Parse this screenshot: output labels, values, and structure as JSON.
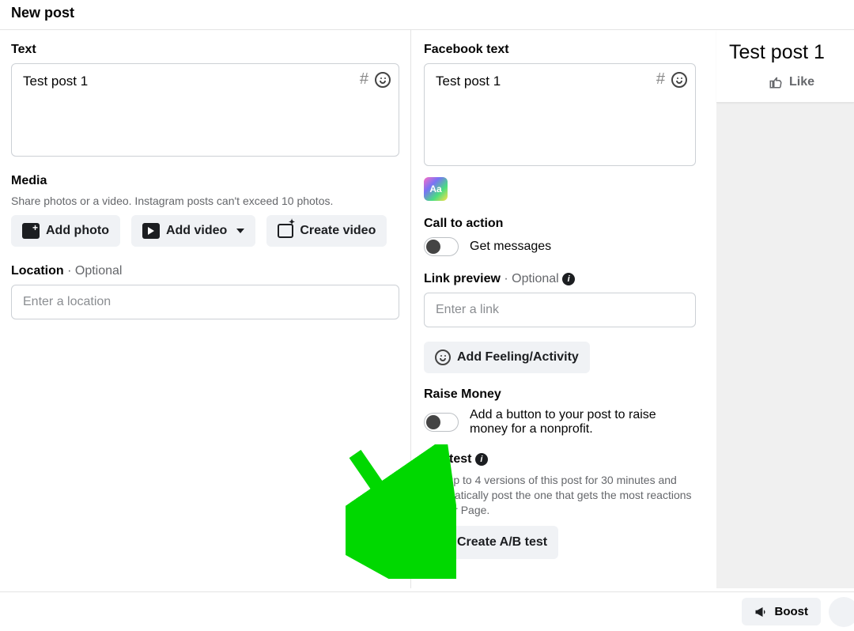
{
  "header": {
    "title": "New post"
  },
  "left": {
    "text_label": "Text",
    "text_value": "Test post 1",
    "media_label": "Media",
    "media_subtext": "Share photos or a video. Instagram posts can't exceed 10 photos.",
    "add_photo": "Add photo",
    "add_video": "Add video",
    "create_video": "Create video",
    "location_label": "Location",
    "location_optional": " · Optional",
    "location_placeholder": "Enter a location"
  },
  "right": {
    "fb_text_label": "Facebook text",
    "fb_text_value": "Test post 1",
    "aa_label": "Aa",
    "cta_label": "Call to action",
    "cta_get_messages": "Get messages",
    "link_preview_label": "Link preview",
    "link_preview_optional": " · Optional",
    "link_placeholder": "Enter a link",
    "add_feeling": "Add Feeling/Activity",
    "raise_money_label": "Raise Money",
    "raise_money_text": "Add a button to your post to raise money for a nonprofit.",
    "ab_label": "A/B test",
    "ab_desc": "Test up to 4 versions of this post for 30 minutes and automatically post the one that gets the most reactions to your Page.",
    "ab_button": "Create A/B test"
  },
  "preview": {
    "text": "Test post 1",
    "like": "Like"
  },
  "footer": {
    "boost": "Boost"
  }
}
